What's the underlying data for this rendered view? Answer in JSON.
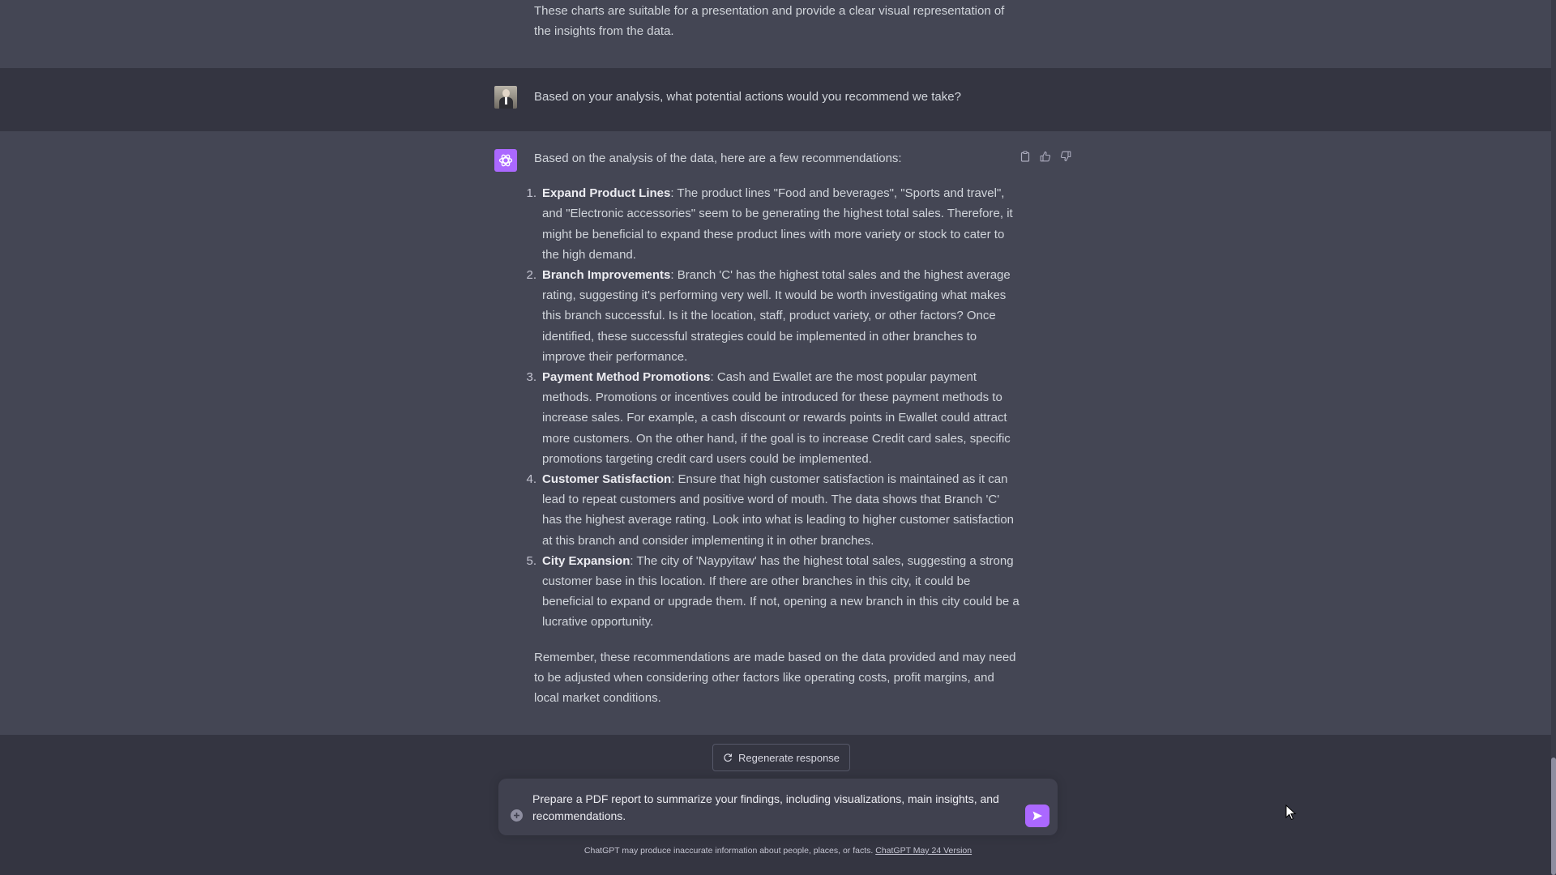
{
  "previous_message": {
    "text": "These charts are suitable for a presentation and provide a clear visual representation of the insights from the data."
  },
  "user_message": {
    "text": "Based on your analysis, what potential actions would you recommend we take?"
  },
  "assistant_message": {
    "intro": "Based on the analysis of the data, here are a few recommendations:",
    "recommendations": [
      {
        "number": "1.",
        "title": "Expand Product Lines",
        "text": ": The product lines \"Food and beverages\", \"Sports and travel\", and \"Electronic accessories\" seem to be generating the highest total sales. Therefore, it might be beneficial to expand these product lines with more variety or stock to cater to the high demand."
      },
      {
        "number": "2.",
        "title": "Branch Improvements",
        "text": ": Branch 'C' has the highest total sales and the highest average rating, suggesting it's performing very well. It would be worth investigating what makes this branch successful. Is it the location, staff, product variety, or other factors? Once identified, these successful strategies could be implemented in other branches to improve their performance."
      },
      {
        "number": "3.",
        "title": "Payment Method Promotions",
        "text": ": Cash and Ewallet are the most popular payment methods. Promotions or incentives could be introduced for these payment methods to increase sales. For example, a cash discount or rewards points in Ewallet could attract more customers. On the other hand, if the goal is to increase Credit card sales, specific promotions targeting credit card users could be implemented."
      },
      {
        "number": "4.",
        "title": "Customer Satisfaction",
        "text": ": Ensure that high customer satisfaction is maintained as it can lead to repeat customers and positive word of mouth. The data shows that Branch 'C' has the highest average rating. Look into what is leading to higher customer satisfaction at this branch and consider implementing it in other branches."
      },
      {
        "number": "5.",
        "title": "City Expansion",
        "text": ": The city of 'Naypyitaw' has the highest total sales, suggesting a strong customer base in this location. If there are other branches in this city, it could be beneficial to expand or upgrade them. If not, opening a new branch in this city could be a lucrative opportunity."
      }
    ],
    "closing": "Remember, these recommendations are made based on the data provided and may need to be adjusted when considering other factors like operating costs, profit margins, and local market conditions."
  },
  "actions": {
    "regenerate_label": "Regenerate response"
  },
  "composer": {
    "value": "Prepare a PDF report to summarize your findings, including visualizations, main insights, and recommendations."
  },
  "footer": {
    "disclaimer": "ChatGPT may produce inaccurate information about people, places, or facts. ",
    "version_link": "ChatGPT May 24 Version"
  },
  "colors": {
    "background": "#343541",
    "assistant_row": "#444654",
    "accent": "#ab68ff"
  },
  "icons": [
    "sidebar-toggle-icon",
    "user-avatar",
    "chatgpt-logo-icon",
    "copy-icon",
    "thumbs-up-icon",
    "thumbs-down-icon",
    "refresh-icon",
    "plus-icon",
    "send-icon",
    "cursor-icon"
  ]
}
